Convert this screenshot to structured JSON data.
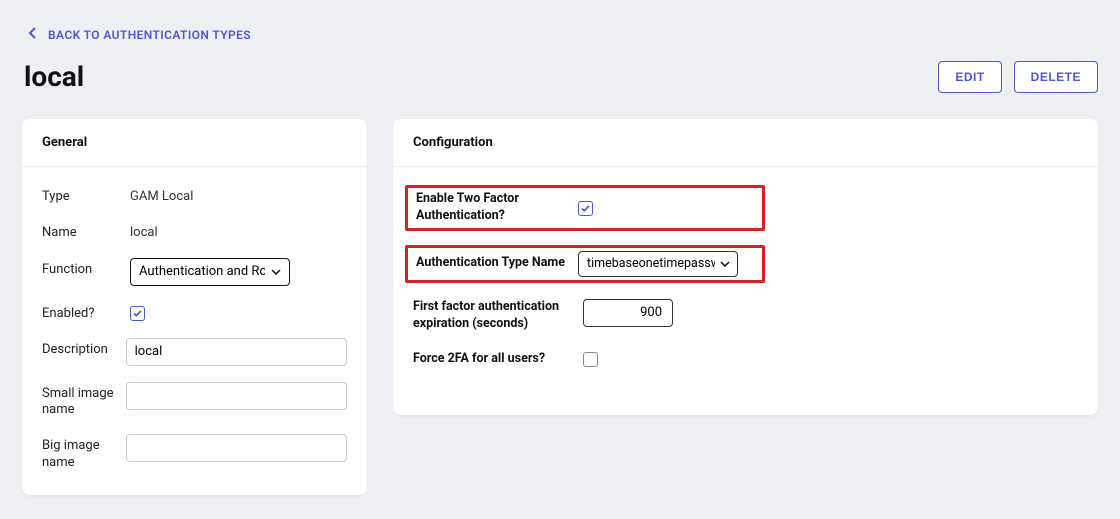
{
  "back_link": "BACK TO AUTHENTICATION TYPES",
  "page_title": "local",
  "actions": {
    "edit": "EDIT",
    "delete": "DELETE"
  },
  "general": {
    "heading": "General",
    "type_label": "Type",
    "type_value": "GAM Local",
    "name_label": "Name",
    "name_value": "local",
    "function_label": "Function",
    "function_value": "Authentication and Roles",
    "enabled_label": "Enabled?",
    "enabled_checked": true,
    "description_label": "Description",
    "description_value": "local",
    "small_image_label": "Small image name",
    "small_image_value": "",
    "big_image_label": "Big image name",
    "big_image_value": ""
  },
  "configuration": {
    "heading": "Configuration",
    "enable_2fa_label": "Enable Two Factor Authentication?",
    "enable_2fa_checked": true,
    "auth_type_name_label": "Authentication Type Name",
    "auth_type_name_value": "timebaseonetimepassword",
    "first_factor_label": "First factor authentication expiration (seconds)",
    "first_factor_value": "900",
    "force_2fa_label": "Force 2FA for all users?",
    "force_2fa_checked": false
  }
}
